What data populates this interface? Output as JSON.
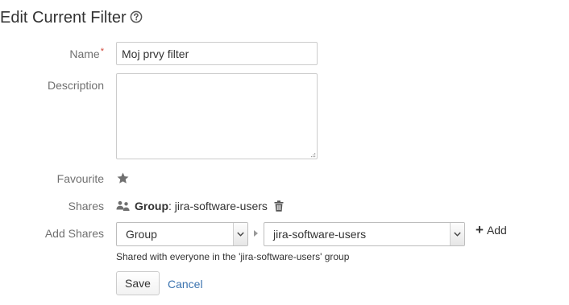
{
  "page": {
    "title": "Edit Current Filter",
    "help_icon": "question-circle-icon"
  },
  "form": {
    "name_label": "Name",
    "required_marker": "*",
    "name_value": "Moj prvy filter",
    "description_label": "Description",
    "description_value": "",
    "favourite_label": "Favourite",
    "favourite_icon": "star-icon",
    "shares_label": "Shares",
    "share": {
      "icon": "group-icon",
      "type": "Group",
      "separator": ":",
      "value": "jira-software-users",
      "delete_icon": "trash-icon"
    },
    "add_shares_label": "Add Shares",
    "add_shares_type": "Group",
    "add_shares_group": "jira-software-users",
    "add_label": "Add",
    "hint": "Shared with everyone in the 'jira-software-users' group"
  },
  "actions": {
    "save_label": "Save",
    "cancel_label": "Cancel"
  },
  "colors": {
    "link": "#3b73af",
    "required": "#d04437",
    "label": "#707070",
    "text": "#333333"
  }
}
